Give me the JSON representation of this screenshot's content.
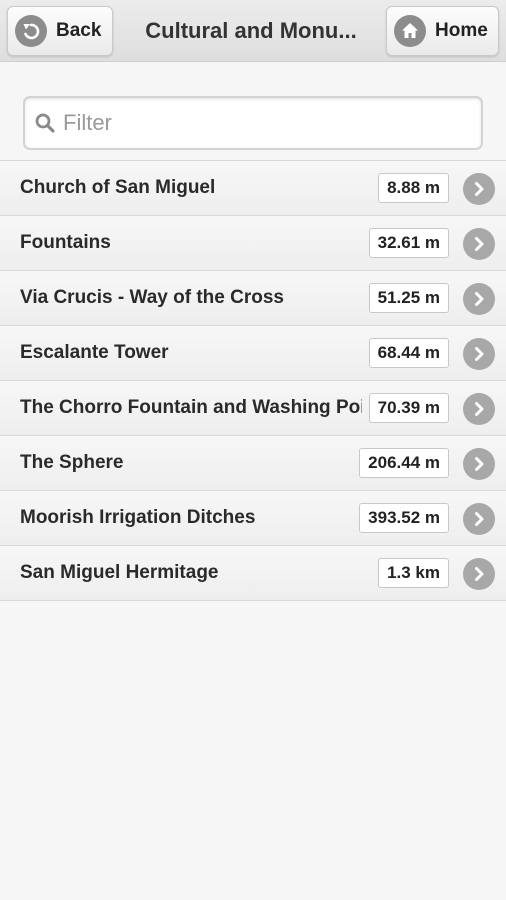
{
  "header": {
    "back_label": "Back",
    "title": "Cultural and Monu...",
    "home_label": "Home"
  },
  "filter": {
    "placeholder": "Filter",
    "value": ""
  },
  "items": [
    {
      "label": "Church of San Miguel",
      "distance": "8.88 m"
    },
    {
      "label": "Fountains",
      "distance": "32.61 m"
    },
    {
      "label": "Via Crucis - Way of the Cross",
      "distance": "51.25 m"
    },
    {
      "label": "Escalante Tower",
      "distance": "68.44 m"
    },
    {
      "label": "The Chorro Fountain and Washing Poin",
      "distance": "70.39 m"
    },
    {
      "label": "The Sphere",
      "distance": "206.44 m"
    },
    {
      "label": "Moorish Irrigation Ditches",
      "distance": "393.52 m"
    },
    {
      "label": "San Miguel Hermitage",
      "distance": "1.3 km"
    }
  ],
  "icons": {
    "back": "back-arrow-icon",
    "home": "home-icon",
    "search": "search-icon",
    "row": "chevron-right-icon"
  },
  "colors": {
    "background": "#f6f6f6",
    "icon_gray": "#a8a8a8"
  }
}
